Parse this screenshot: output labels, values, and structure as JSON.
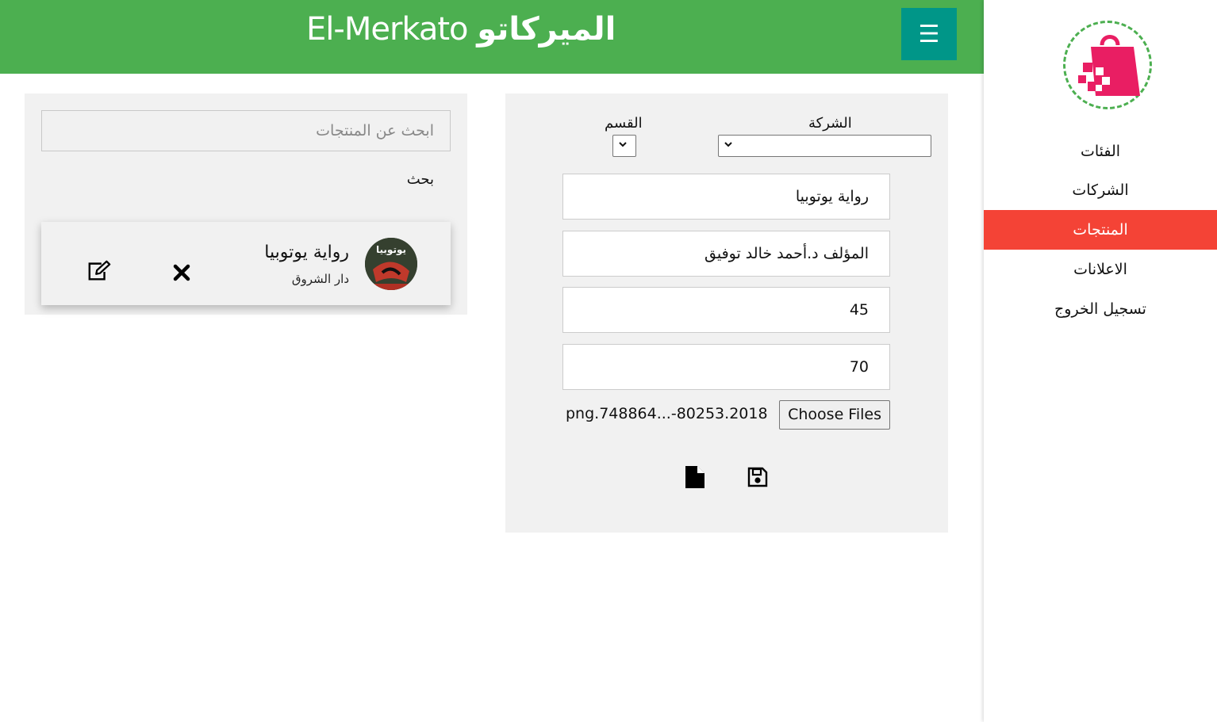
{
  "header": {
    "title_en": "El-Merkato",
    "title_ar": "الميركاتو",
    "menu_icon": "☰"
  },
  "sidebar": {
    "logo": "shopping-bag-logo",
    "items": [
      {
        "label": "الفئات",
        "active": false
      },
      {
        "label": "الشركات",
        "active": false
      },
      {
        "label": "المنتجات",
        "active": true
      },
      {
        "label": "الاعلانات",
        "active": false
      },
      {
        "label": "تسجيل الخروج",
        "active": false
      }
    ],
    "active_color": "#f44336"
  },
  "form": {
    "company_label": "الشركة",
    "company_value": "",
    "section_label": "القسم",
    "section_value": "",
    "name_value": "رواية يوتوبيا",
    "description_value": "المؤلف د.أحمد خالد توفيق",
    "field3_value": "45",
    "field4_value": "70",
    "choose_files_label": "Choose Files",
    "file_name": "png.748864...-80253.2018",
    "new_icon": "file-icon",
    "save_icon": "floppy-disk-icon"
  },
  "search": {
    "placeholder": "ابحث عن المنتجات",
    "label": "بحث"
  },
  "products": [
    {
      "title": "رواية يوتوبيا",
      "company": "دار الشروق",
      "thumb_text": "يوتوبيا",
      "delete_icon": "close-icon",
      "edit_icon": "edit-icon"
    }
  ],
  "colors": {
    "header": "#4caf50",
    "menu_button": "#009688",
    "panel": "#f1f1f1",
    "logo_bag": "#e91e63"
  }
}
